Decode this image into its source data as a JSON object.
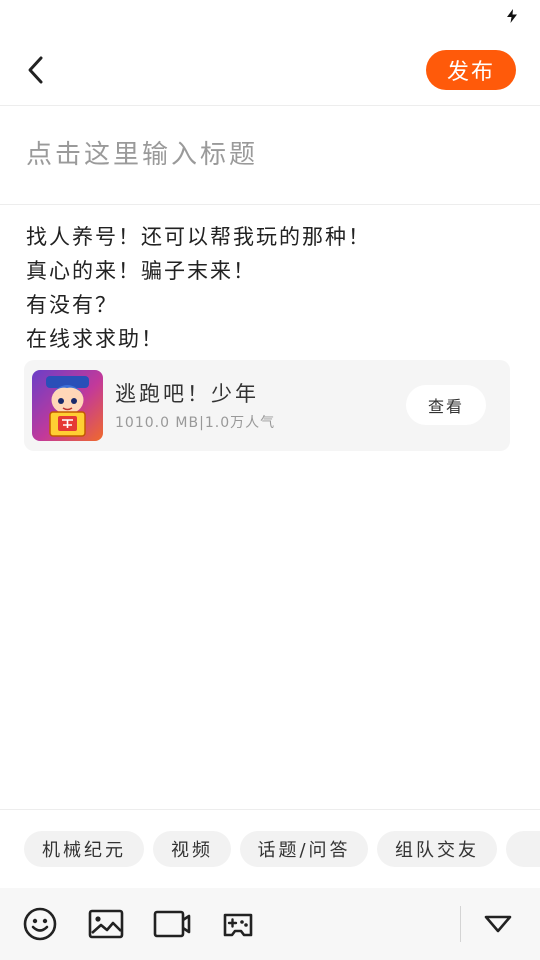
{
  "status_bar": {
    "charging_icon": "charging-bolt-icon"
  },
  "header": {
    "back_icon": "chevron-left-icon",
    "publish_label": "发布",
    "accent_color": "#ff5a0a"
  },
  "title_field": {
    "placeholder": "点击这里输入标题",
    "value": ""
  },
  "body": {
    "lines": [
      "找人养号！还可以帮我玩的那种！",
      "真心的来！骗子末来！",
      "有没有？",
      "在线求求助！"
    ]
  },
  "app_card": {
    "name": "逃跑吧！少年",
    "meta": "1010.0 MB|1.0万人气",
    "view_label": "查看"
  },
  "tags": [
    "机械纪元",
    "视频",
    "话题/问答",
    "组队交友"
  ],
  "toolbar": {
    "icons": [
      "emoji-icon",
      "image-icon",
      "video-icon",
      "gamepad-icon",
      "collapse-triangle-icon"
    ]
  }
}
